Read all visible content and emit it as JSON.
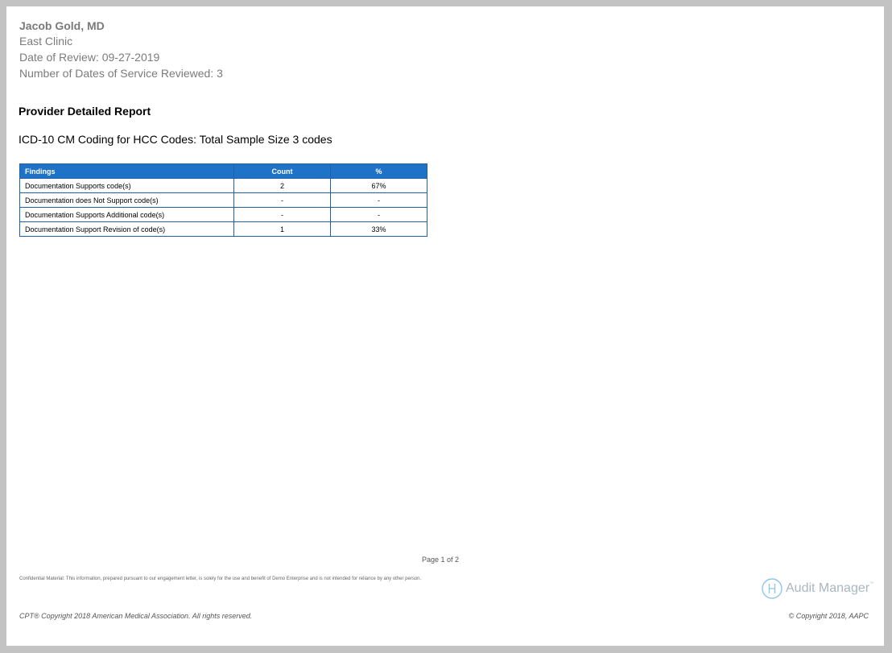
{
  "header": {
    "provider_name": "Jacob  Gold, MD",
    "clinic": "East Clinic",
    "date_of_review": "Date of Review: 09-27-2019",
    "dates_reviewed": "Number of Dates of Service Reviewed: 3"
  },
  "report": {
    "title": "Provider Detailed Report",
    "subtitle": "ICD-10 CM Coding for HCC Codes: Total Sample Size 3 codes"
  },
  "table": {
    "columns": [
      "Findings",
      "Count",
      "%"
    ],
    "rows": [
      [
        "Documentation Supports code(s)",
        "2",
        "67%"
      ],
      [
        "Documentation does Not Support code(s)",
        "-",
        "-"
      ],
      [
        "Documentation Supports Additional code(s)",
        "-",
        "-"
      ],
      [
        "Documentation Support Revision of code(s)",
        "1",
        "33%"
      ]
    ]
  },
  "footer": {
    "page": "Page 1 of 2",
    "confidential": "Confidential Material: This information, prepared pursuant to our engagement letter, is solely for the use and benefit of Demo Enterprise and is not intended for reliance by any other person.",
    "logo_text": "Audit Manager",
    "logo_tm": "™",
    "cpt_copyright": "CPT® Copyright 2018 American Medical Association. All rights reserved.",
    "aapc_copyright": "© Copyright 2018, AAPC"
  },
  "colors": {
    "table_header_bg": "#1e73c9",
    "table_border": "#1e5fa8",
    "page_bg": "#ffffff",
    "frame_bg": "#c3c3c3"
  }
}
